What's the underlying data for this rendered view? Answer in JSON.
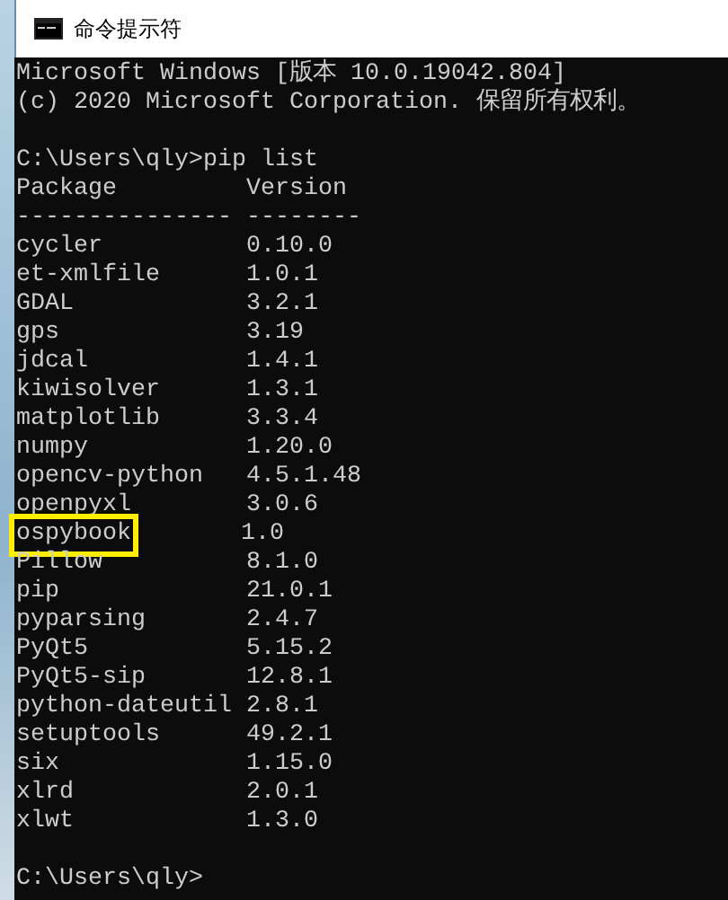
{
  "window": {
    "title": "命令提示符"
  },
  "console": {
    "banner": [
      "Microsoft Windows [版本 10.0.19042.804]",
      "(c) 2020 Microsoft Corporation. 保留所有权利。"
    ],
    "command": "C:\\Users\\qly>pip list",
    "columns": [
      "Package",
      "Version"
    ],
    "separators": [
      "---------------",
      "--------"
    ],
    "rows": [
      {
        "name": "cycler",
        "version": "0.10.0",
        "highlighted": false
      },
      {
        "name": "et-xmlfile",
        "version": "1.0.1",
        "highlighted": false
      },
      {
        "name": "GDAL",
        "version": "3.2.1",
        "highlighted": false
      },
      {
        "name": "gps",
        "version": "3.19",
        "highlighted": false
      },
      {
        "name": "jdcal",
        "version": "1.4.1",
        "highlighted": false
      },
      {
        "name": "kiwisolver",
        "version": "1.3.1",
        "highlighted": false
      },
      {
        "name": "matplotlib",
        "version": "3.3.4",
        "highlighted": false
      },
      {
        "name": "numpy",
        "version": "1.20.0",
        "highlighted": false
      },
      {
        "name": "opencv-python",
        "version": "4.5.1.48",
        "highlighted": false
      },
      {
        "name": "openpyxl",
        "version": "3.0.6",
        "highlighted": false
      },
      {
        "name": "ospybook",
        "version": "1.0",
        "highlighted": true
      },
      {
        "name": "Pillow",
        "version": "8.1.0",
        "highlighted": false
      },
      {
        "name": "pip",
        "version": "21.0.1",
        "highlighted": false
      },
      {
        "name": "pyparsing",
        "version": "2.4.7",
        "highlighted": false
      },
      {
        "name": "PyQt5",
        "version": "5.15.2",
        "highlighted": false
      },
      {
        "name": "PyQt5-sip",
        "version": "12.8.1",
        "highlighted": false
      },
      {
        "name": "python-dateutil",
        "version": "2.8.1",
        "highlighted": false
      },
      {
        "name": "setuptools",
        "version": "49.2.1",
        "highlighted": false
      },
      {
        "name": "six",
        "version": "1.15.0",
        "highlighted": false
      },
      {
        "name": "xlrd",
        "version": "2.0.1",
        "highlighted": false
      },
      {
        "name": "xlwt",
        "version": "1.3.0",
        "highlighted": false
      }
    ],
    "prompt": "C:\\Users\\qly>"
  }
}
